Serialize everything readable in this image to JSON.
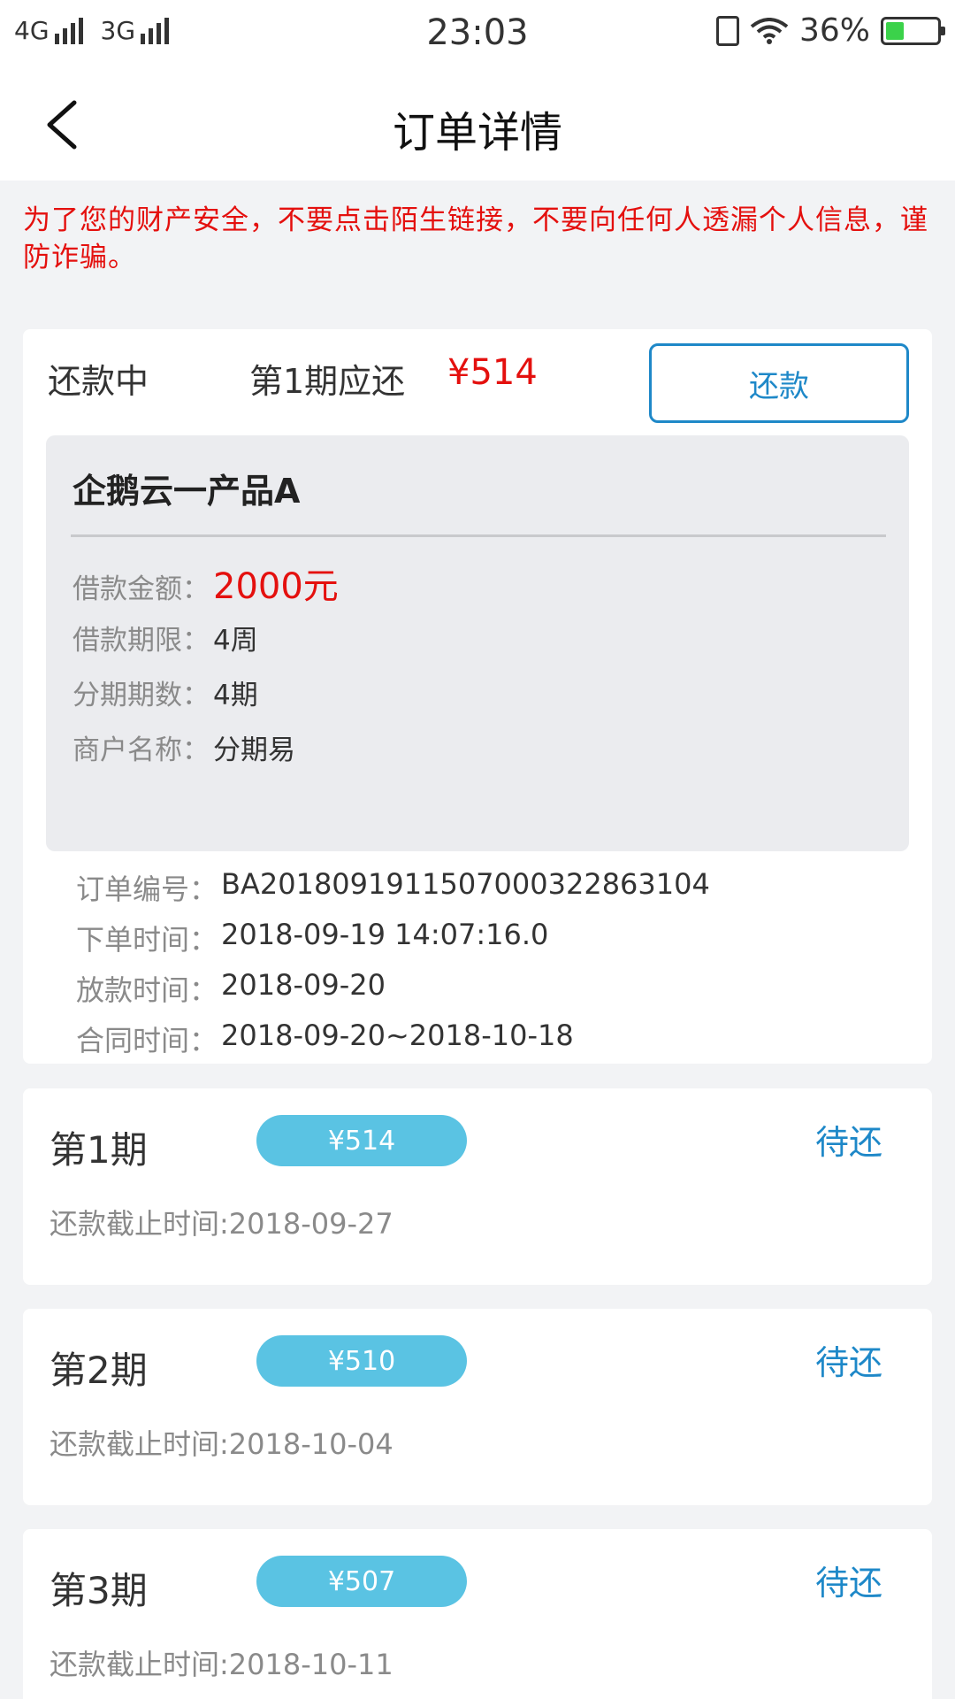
{
  "status_bar": {
    "network1": "4G",
    "network2": "3G",
    "time": "23:03",
    "battery_percent": "36%",
    "battery_level": 0.36
  },
  "nav": {
    "title": "订单详情"
  },
  "warning": "为了您的财产安全，不要点击陌生链接，不要向任何人透漏个人信息，谨防诈骗。",
  "summary": {
    "status": "还款中",
    "period_label": "第1期应还",
    "amount": "¥514",
    "repay_button": "还款",
    "product": {
      "name": "企鹅云一产品A",
      "rows": [
        {
          "label": "借款金额：",
          "value": "2000元"
        },
        {
          "label": "借款期限：",
          "value": "4周"
        },
        {
          "label": "分期期数：",
          "value": "4期"
        },
        {
          "label": "商户名称：",
          "value": "分期易"
        }
      ]
    },
    "order_rows": [
      {
        "label": "订单编号：",
        "value": "BA2018091911507000322863104"
      },
      {
        "label": "下单时间：",
        "value": "2018-09-19 14:07:16.0"
      },
      {
        "label": "放款时间：",
        "value": "2018-09-20"
      },
      {
        "label": "合同时间：",
        "value": "2018-09-20~2018-10-18"
      }
    ]
  },
  "installments": [
    {
      "title": "第1期",
      "amount": "¥514",
      "status": "待还",
      "due": "还款截止时间:2018-09-27"
    },
    {
      "title": "第2期",
      "amount": "¥510",
      "status": "待还",
      "due": "还款截止时间:2018-10-04"
    },
    {
      "title": "第3期",
      "amount": "¥507",
      "status": "待还",
      "due": "还款截止时间:2018-10-11"
    }
  ]
}
